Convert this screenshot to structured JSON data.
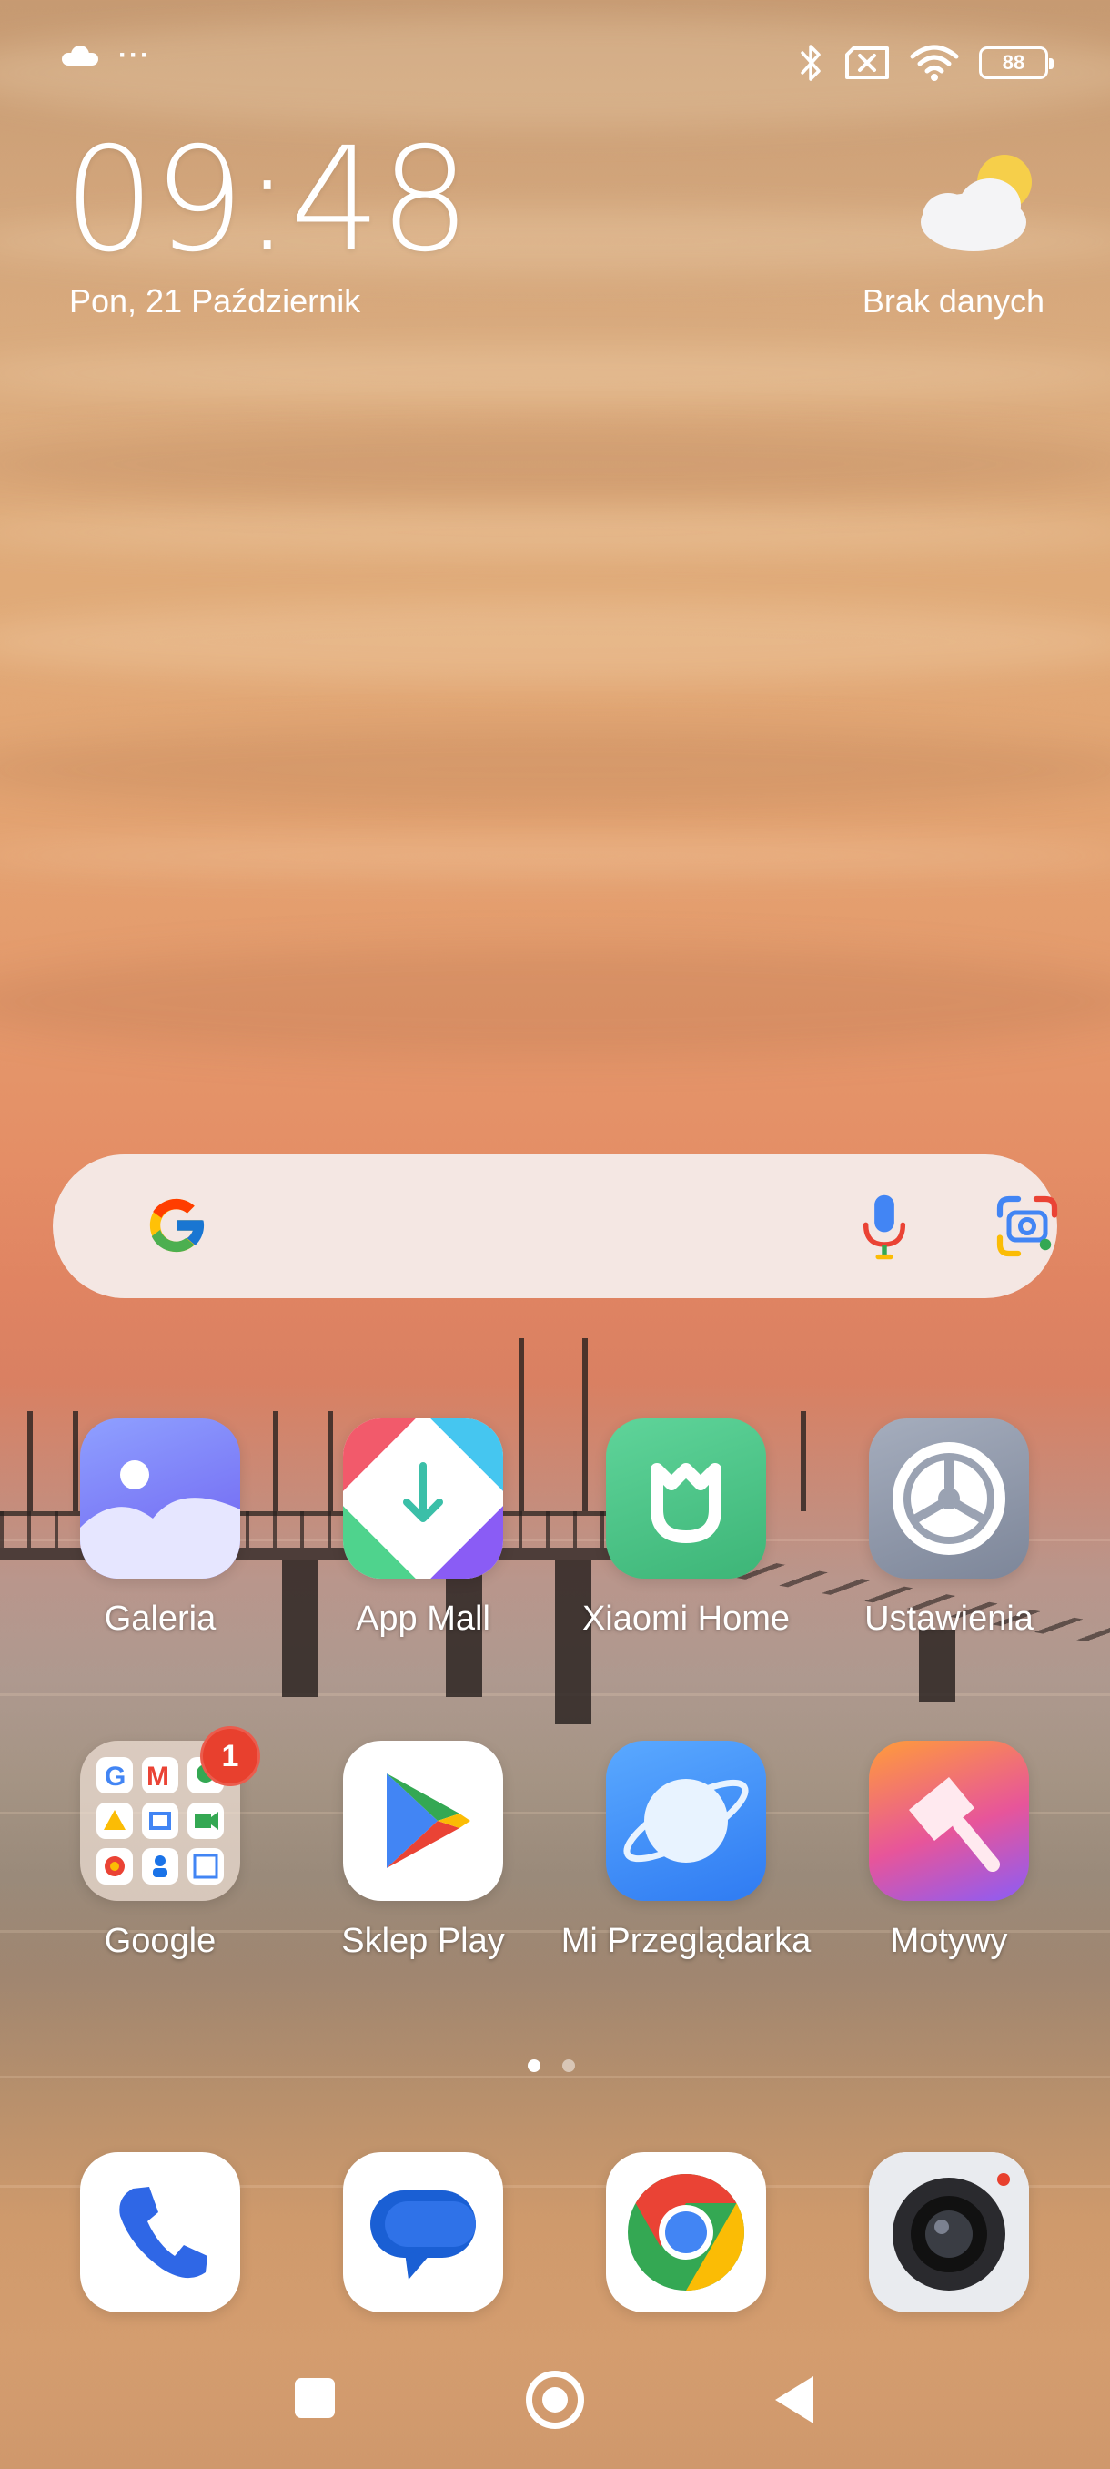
{
  "status_bar": {
    "left_icons": [
      "cloud-icon"
    ],
    "dots": "···",
    "right_icons": [
      "bluetooth-icon",
      "no-sim-icon",
      "wifi-icon"
    ],
    "battery": "88"
  },
  "clock_widget": {
    "time": "09:48",
    "date": "Pon, 21 Październik"
  },
  "weather_widget": {
    "icon": "partly-cloudy-icon",
    "text": "Brak danych"
  },
  "search_bar": {
    "placeholder": "",
    "logo": "google-logo",
    "icons": [
      "microphone-icon",
      "google-lens-icon"
    ]
  },
  "apps": [
    {
      "label": "Galeria",
      "icon": "gallery-icon"
    },
    {
      "label": "App Mall",
      "icon": "app-mall-icon"
    },
    {
      "label": "Xiaomi Home",
      "icon": "xiaomi-home-icon"
    },
    {
      "label": "Ustawienia",
      "icon": "settings-icon"
    },
    {
      "label": "Google",
      "icon": "google-folder-icon",
      "badge": "1"
    },
    {
      "label": "Sklep Play",
      "icon": "play-store-icon"
    },
    {
      "label": "Mi Przeglądarka",
      "icon": "mi-browser-icon"
    },
    {
      "label": "Motywy",
      "icon": "themes-icon"
    }
  ],
  "page_indicator": {
    "pages": 2,
    "current": 1
  },
  "dock": [
    "phone-icon",
    "messages-icon",
    "chrome-icon",
    "camera-icon"
  ],
  "navbar": [
    "recents-button",
    "home-button",
    "back-button"
  ],
  "colors": {
    "badge": "#e8402e",
    "search_bg": "#f4ecea"
  }
}
